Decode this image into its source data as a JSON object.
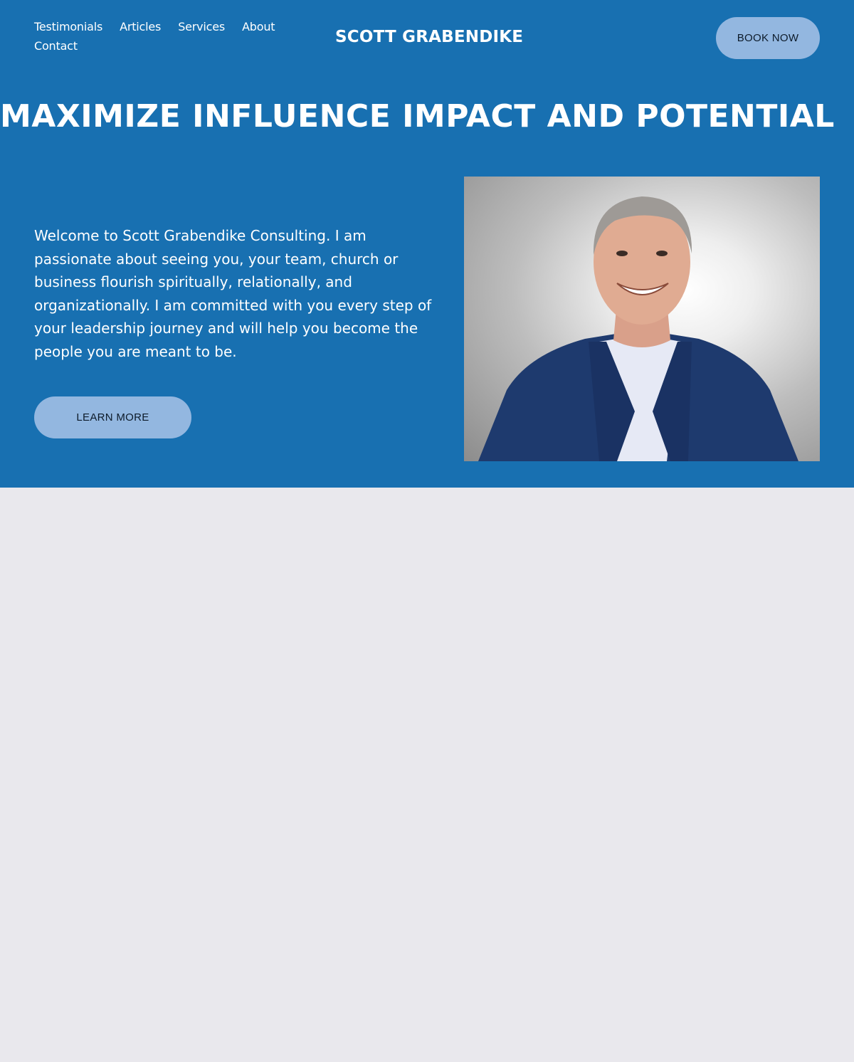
{
  "site": {
    "brand": "SCOTT GRABENDIKE",
    "nav": [
      "Testimonials",
      "Articles",
      "Services",
      "About",
      "Contact"
    ]
  },
  "header": {
    "book_label": "BOOK NOW"
  },
  "hero": {
    "headline": "MAXIMIZE INFLUENCE IMPACT AND POTENTIAL",
    "intro": "Welcome to Scott Grabendike Consulting. I am passionate about seeing you, your team, church or business flourish spiritually, relationally, and organizationally. I am committed with you every step of your leadership journey and will help you become the people you are meant to be.",
    "learn_more_label": "LEARN MORE"
  },
  "colors": {
    "hero_background": "#1870b1",
    "button_background": "#93b7e0",
    "section_background": "#e9e8ed",
    "text_on_hero": "#ffffff"
  }
}
